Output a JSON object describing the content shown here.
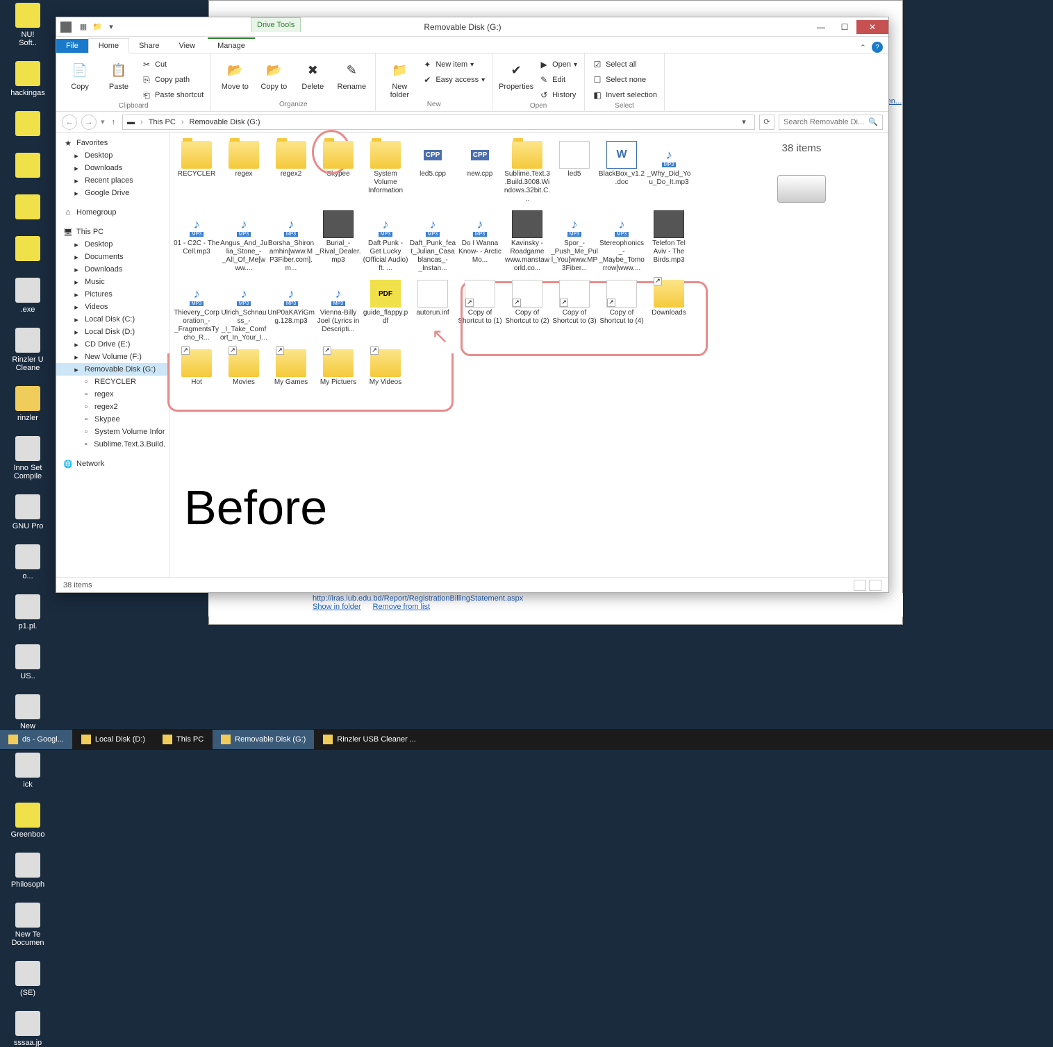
{
  "desktop": {
    "icons": [
      "NU!\nSoft..",
      "hackingas",
      "",
      "",
      "",
      "",
      ".exe",
      "Rinzler U\nCleane",
      "rinzler",
      "Inno Set\nCompile",
      "GNU Pro",
      "o...",
      "p1.pl.",
      "US..",
      "New\nMicrosof",
      "ick",
      "Greenboo",
      "Philosoph",
      "New Te\nDocumen",
      "(SE)",
      "sssaa.jp"
    ]
  },
  "window": {
    "title": "Removable Disk (G:)",
    "tooltab": "Drive Tools",
    "tabs": {
      "file": "File",
      "home": "Home",
      "share": "Share",
      "view": "View",
      "manage": "Manage"
    },
    "ribbon": {
      "clipboard": {
        "label": "Clipboard",
        "copy": "Copy",
        "paste": "Paste",
        "cut": "Cut",
        "copypath": "Copy path",
        "pasteshort": "Paste shortcut"
      },
      "organize": {
        "label": "Organize",
        "moveto": "Move\nto",
        "copyto": "Copy\nto",
        "delete": "Delete",
        "rename": "Rename"
      },
      "new": {
        "label": "New",
        "newfolder": "New\nfolder",
        "newitem": "New item",
        "easyaccess": "Easy access"
      },
      "open": {
        "label": "Open",
        "properties": "Properties",
        "open": "Open",
        "edit": "Edit",
        "history": "History"
      },
      "select": {
        "label": "Select",
        "all": "Select all",
        "none": "Select none",
        "invert": "Invert selection"
      }
    },
    "breadcrumb": {
      "pc": "This PC",
      "drive": "Removable Disk (G:)"
    },
    "search_placeholder": "Search Removable Di...",
    "nav": {
      "favorites": {
        "head": "Favorites",
        "items": [
          "Desktop",
          "Downloads",
          "Recent places",
          "Google Drive"
        ]
      },
      "homegroup": "Homegroup",
      "thispc": {
        "head": "This PC",
        "items": [
          "Desktop",
          "Documents",
          "Downloads",
          "Music",
          "Pictures",
          "Videos",
          "Local Disk (C:)",
          "Local Disk (D:)",
          "CD Drive (E:)",
          "New Volume (F:)",
          "Removable Disk (G:)"
        ],
        "sub": [
          "RECYCLER",
          "regex",
          "regex2",
          "Skypee",
          "System Volume Infor",
          "Sublime.Text.3.Build."
        ]
      },
      "network": "Network"
    },
    "files": [
      {
        "t": "folder",
        "n": "RECYCLER"
      },
      {
        "t": "folder",
        "n": "regex"
      },
      {
        "t": "folder",
        "n": "regex2"
      },
      {
        "t": "folder",
        "n": "Skypee"
      },
      {
        "t": "folder",
        "n": "System Volume Information"
      },
      {
        "t": "cpp",
        "n": "led5.cpp"
      },
      {
        "t": "cpp",
        "n": "new.cpp"
      },
      {
        "t": "folder",
        "n": "Sublime.Text.3.Build.3008.Windows.32bit.C..."
      },
      {
        "t": "file",
        "n": "led5"
      },
      {
        "t": "doc",
        "n": "BlackBox_v1.2.doc"
      },
      {
        "t": "mp3",
        "n": "_Why_Did_You_Do_It.mp3"
      },
      {
        "t": "mp3",
        "n": "01 - C2C - The Cell.mp3"
      },
      {
        "t": "mp3",
        "n": "Angus_And_Julia_Stone_-_All_Of_Me[www...."
      },
      {
        "t": "mp3",
        "n": "Borsha_Shironamhin[www.MP3Fiber.com].m..."
      },
      {
        "t": "img",
        "n": "Burial_-_Rival_Dealer.mp3"
      },
      {
        "t": "mp3",
        "n": "Daft Punk - Get Lucky (Official Audio) ft. ..."
      },
      {
        "t": "mp3",
        "n": "Daft_Punk_feat_Julian_Casablancas_-_Instan..."
      },
      {
        "t": "mp3",
        "n": "Do I Wanna Know- - Arctic Mo..."
      },
      {
        "t": "img",
        "n": "Kavinsky - Roadgame www.manstaworld.co..."
      },
      {
        "t": "mp3",
        "n": "Spor_-_Push_Me_Pull_You[www.MP3Fiber..."
      },
      {
        "t": "mp3",
        "n": "Stereophonics_-_Maybe_Tomorrow[www...."
      },
      {
        "t": "img",
        "n": "Telefon Tel Aviv - The Birds.mp3"
      },
      {
        "t": "mp3",
        "n": "Thievery_Corporation_-_FragmentsTycho_R..."
      },
      {
        "t": "mp3",
        "n": "Ulrich_Schnauss_-_I_Take_Comfort_In_Your_I..."
      },
      {
        "t": "mp3",
        "n": "UnP0aKAYiGmg.128.mp3"
      },
      {
        "t": "mp3",
        "n": "Vienna-Billy Joel (Lyrics in Descripti..."
      },
      {
        "t": "pdf",
        "n": "guide_flappy.pdf"
      },
      {
        "t": "file",
        "n": "autorun.inf"
      },
      {
        "t": "file shortcut",
        "n": "Copy of Shortcut to (1)"
      },
      {
        "t": "file shortcut",
        "n": "Copy of Shortcut to (2)"
      },
      {
        "t": "file shortcut",
        "n": "Copy of Shortcut to (3)"
      },
      {
        "t": "file shortcut",
        "n": "Copy of Shortcut to (4)"
      },
      {
        "t": "folder shortcut",
        "n": "Downloads"
      },
      {
        "t": "folder shortcut",
        "n": "Hot"
      },
      {
        "t": "folder shortcut",
        "n": "Movies"
      },
      {
        "t": "folder shortcut",
        "n": "My Games"
      },
      {
        "t": "folder shortcut",
        "n": "My Pictuers"
      },
      {
        "t": "folder shortcut",
        "n": "My Videos"
      }
    ],
    "details_count": "38 items",
    "status_count": "38 items",
    "annotation_text": "Before"
  },
  "bg": {
    "url": "http://iras.iub.edu.bd/Report/RegistrationBillingStatement.aspx",
    "show": "Show in folder",
    "remove": "Remove from list",
    "link": "pen..."
  },
  "taskbar": {
    "items": [
      {
        "n": "ds - Googl...",
        "a": true
      },
      {
        "n": "Local Disk (D:)"
      },
      {
        "n": "This PC"
      },
      {
        "n": "Removable Disk (G:)",
        "a": true
      },
      {
        "n": "Rinzler USB Cleaner ..."
      }
    ]
  }
}
